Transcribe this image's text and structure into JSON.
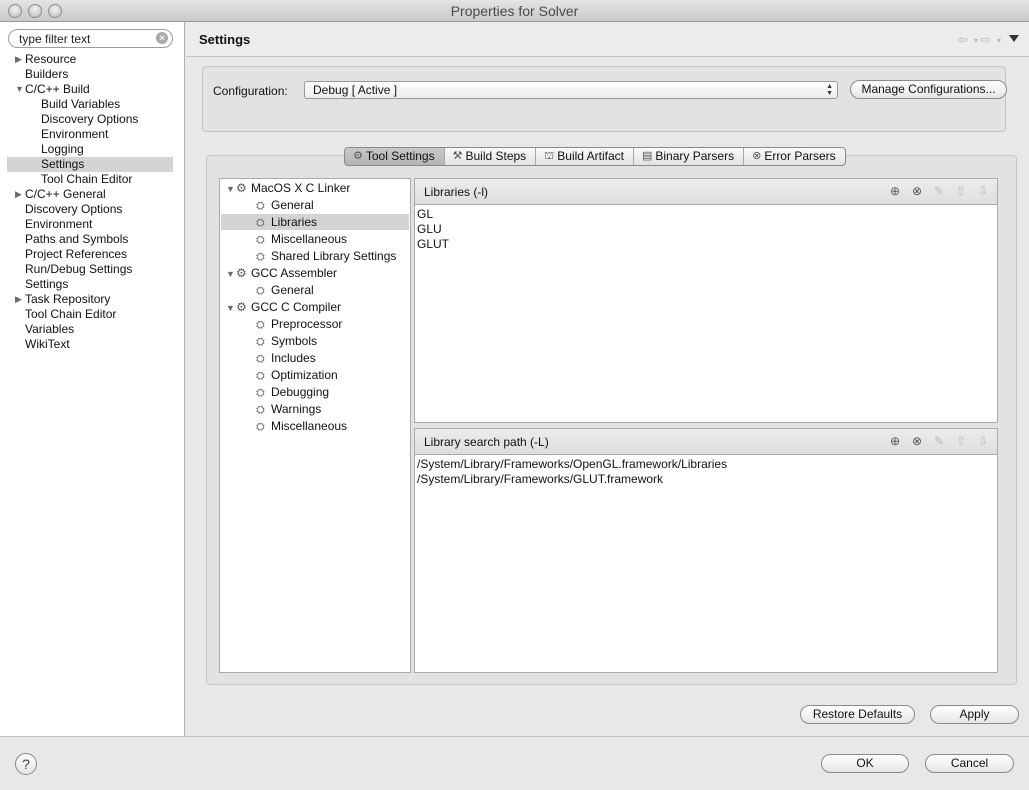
{
  "window": {
    "title": "Properties for Solver"
  },
  "sidebar": {
    "filter_placeholder": "type filter text",
    "items": [
      {
        "label": "Resource",
        "expandable": true,
        "expanded": false,
        "depth": 0
      },
      {
        "label": "Builders",
        "depth": 0
      },
      {
        "label": "C/C++ Build",
        "expandable": true,
        "expanded": true,
        "depth": 0
      },
      {
        "label": "Build Variables",
        "depth": 1
      },
      {
        "label": "Discovery Options",
        "depth": 1
      },
      {
        "label": "Environment",
        "depth": 1
      },
      {
        "label": "Logging",
        "depth": 1
      },
      {
        "label": "Settings",
        "depth": 1,
        "selected": true
      },
      {
        "label": "Tool Chain Editor",
        "depth": 1
      },
      {
        "label": "C/C++ General",
        "expandable": true,
        "expanded": false,
        "depth": 0
      },
      {
        "label": "Discovery Options",
        "depth": 0
      },
      {
        "label": "Environment",
        "depth": 0
      },
      {
        "label": "Paths and Symbols",
        "depth": 0
      },
      {
        "label": "Project References",
        "depth": 0
      },
      {
        "label": "Run/Debug Settings",
        "depth": 0
      },
      {
        "label": "Settings",
        "depth": 0
      },
      {
        "label": "Task Repository",
        "expandable": true,
        "expanded": false,
        "depth": 0
      },
      {
        "label": "Tool Chain Editor",
        "depth": 0
      },
      {
        "label": "Variables",
        "depth": 0
      },
      {
        "label": "WikiText",
        "depth": 0
      }
    ]
  },
  "header": {
    "title": "Settings"
  },
  "configuration": {
    "label": "Configuration:",
    "value": "Debug  [ Active ]",
    "manage_button": "Manage Configurations..."
  },
  "tabs": [
    {
      "label": "Tool Settings",
      "icon": "tool-settings-icon",
      "active": true
    },
    {
      "label": "Build Steps",
      "icon": "build-steps-icon"
    },
    {
      "label": "Build Artifact",
      "icon": "build-artifact-icon"
    },
    {
      "label": "Binary Parsers",
      "icon": "binary-parsers-icon"
    },
    {
      "label": "Error Parsers",
      "icon": "error-parsers-icon"
    }
  ],
  "tool_tree": {
    "groups": [
      {
        "label": "MacOS X C Linker",
        "children": [
          "General",
          "Libraries",
          "Miscellaneous",
          "Shared Library Settings"
        ]
      },
      {
        "label": "GCC Assembler",
        "children": [
          "General"
        ]
      },
      {
        "label": "GCC C Compiler",
        "children": [
          "Preprocessor",
          "Symbols",
          "Includes",
          "Optimization",
          "Debugging",
          "Warnings",
          "Miscellaneous"
        ]
      }
    ],
    "selected": "Libraries"
  },
  "libraries_panel": {
    "title": "Libraries (-l)",
    "items": [
      "GL",
      "GLU",
      "GLUT"
    ]
  },
  "search_path_panel": {
    "title": "Library search path (-L)",
    "items": [
      "/System/Library/Frameworks/OpenGL.framework/Libraries",
      "/System/Library/Frameworks/GLUT.framework"
    ]
  },
  "buttons": {
    "restore_defaults": "Restore Defaults",
    "apply": "Apply",
    "ok": "OK",
    "cancel": "Cancel",
    "help": "?"
  }
}
